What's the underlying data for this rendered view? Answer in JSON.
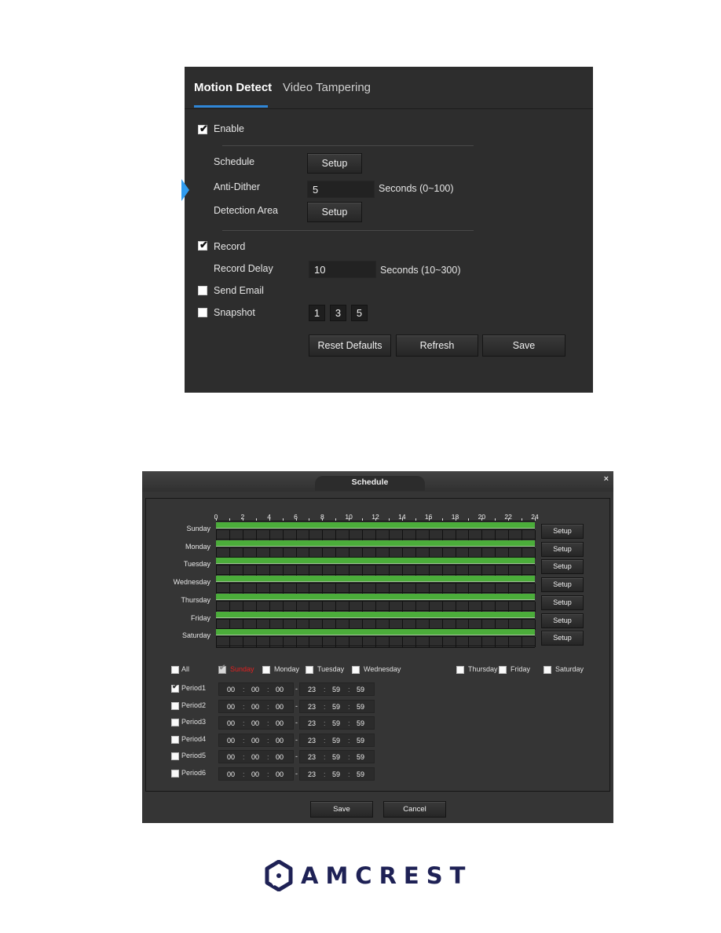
{
  "motion_panel": {
    "tabs": [
      {
        "label": "Motion Detect",
        "active": true
      },
      {
        "label": "Video Tampering",
        "active": false
      }
    ],
    "enable": {
      "label": "Enable",
      "checked": true
    },
    "schedule": {
      "label": "Schedule",
      "button": "Setup"
    },
    "anti_dither": {
      "label": "Anti-Dither",
      "value": "5",
      "unit": "Seconds (0~100)"
    },
    "detection_area": {
      "label": "Detection Area",
      "button": "Setup"
    },
    "record": {
      "label": "Record",
      "checked": true
    },
    "record_delay": {
      "label": "Record Delay",
      "value": "10",
      "unit": "Seconds (10~300)"
    },
    "send_email": {
      "label": "Send Email",
      "checked": false
    },
    "snapshot": {
      "label": "Snapshot",
      "checked": false,
      "options": [
        "1",
        "3",
        "5"
      ]
    },
    "buttons": {
      "reset": "Reset Defaults",
      "refresh": "Refresh",
      "save": "Save"
    },
    "accent_color": "#2f86d6"
  },
  "schedule_dialog": {
    "title": "Schedule",
    "close_icon": "×",
    "hour_ticks": [
      "0",
      "2",
      "4",
      "6",
      "8",
      "10",
      "12",
      "14",
      "16",
      "18",
      "20",
      "22",
      "24"
    ],
    "days": [
      {
        "name": "Sunday",
        "setup": "Setup",
        "periods": [
          [
            0,
            24
          ]
        ]
      },
      {
        "name": "Monday",
        "setup": "Setup",
        "periods": [
          [
            0,
            24
          ]
        ]
      },
      {
        "name": "Tuesday",
        "setup": "Setup",
        "periods": [
          [
            0,
            24
          ]
        ]
      },
      {
        "name": "Wednesday",
        "setup": "Setup",
        "periods": [
          [
            0,
            24
          ]
        ]
      },
      {
        "name": "Thursday",
        "setup": "Setup",
        "periods": [
          [
            0,
            24
          ]
        ]
      },
      {
        "name": "Friday",
        "setup": "Setup",
        "periods": [
          [
            0,
            24
          ]
        ]
      },
      {
        "name": "Saturday",
        "setup": "Setup",
        "periods": [
          [
            0,
            24
          ]
        ]
      }
    ],
    "bar_color": "#4bad3a",
    "day_select": {
      "all": {
        "label": "All",
        "checked": false
      },
      "items": [
        {
          "label": "Sunday",
          "checked": true,
          "current": true
        },
        {
          "label": "Monday",
          "checked": false
        },
        {
          "label": "Tuesday",
          "checked": false
        },
        {
          "label": "Wednesday",
          "checked": false
        },
        {
          "label": "Thursday",
          "checked": false
        },
        {
          "label": "Friday",
          "checked": false
        },
        {
          "label": "Saturday",
          "checked": false
        }
      ],
      "current_color": "#e02020"
    },
    "periods": [
      {
        "label": "Period1",
        "checked": true,
        "start": [
          "00",
          "00",
          "00"
        ],
        "end": [
          "23",
          "59",
          "59"
        ]
      },
      {
        "label": "Period2",
        "checked": false,
        "start": [
          "00",
          "00",
          "00"
        ],
        "end": [
          "23",
          "59",
          "59"
        ]
      },
      {
        "label": "Period3",
        "checked": false,
        "start": [
          "00",
          "00",
          "00"
        ],
        "end": [
          "23",
          "59",
          "59"
        ]
      },
      {
        "label": "Period4",
        "checked": false,
        "start": [
          "00",
          "00",
          "00"
        ],
        "end": [
          "23",
          "59",
          "59"
        ]
      },
      {
        "label": "Period5",
        "checked": false,
        "start": [
          "00",
          "00",
          "00"
        ],
        "end": [
          "23",
          "59",
          "59"
        ]
      },
      {
        "label": "Period6",
        "checked": false,
        "start": [
          "00",
          "00",
          "00"
        ],
        "end": [
          "23",
          "59",
          "59"
        ]
      }
    ],
    "footer": {
      "save": "Save",
      "cancel": "Cancel"
    }
  },
  "brand": {
    "name": "AMCREST",
    "color": "#1e2155"
  }
}
